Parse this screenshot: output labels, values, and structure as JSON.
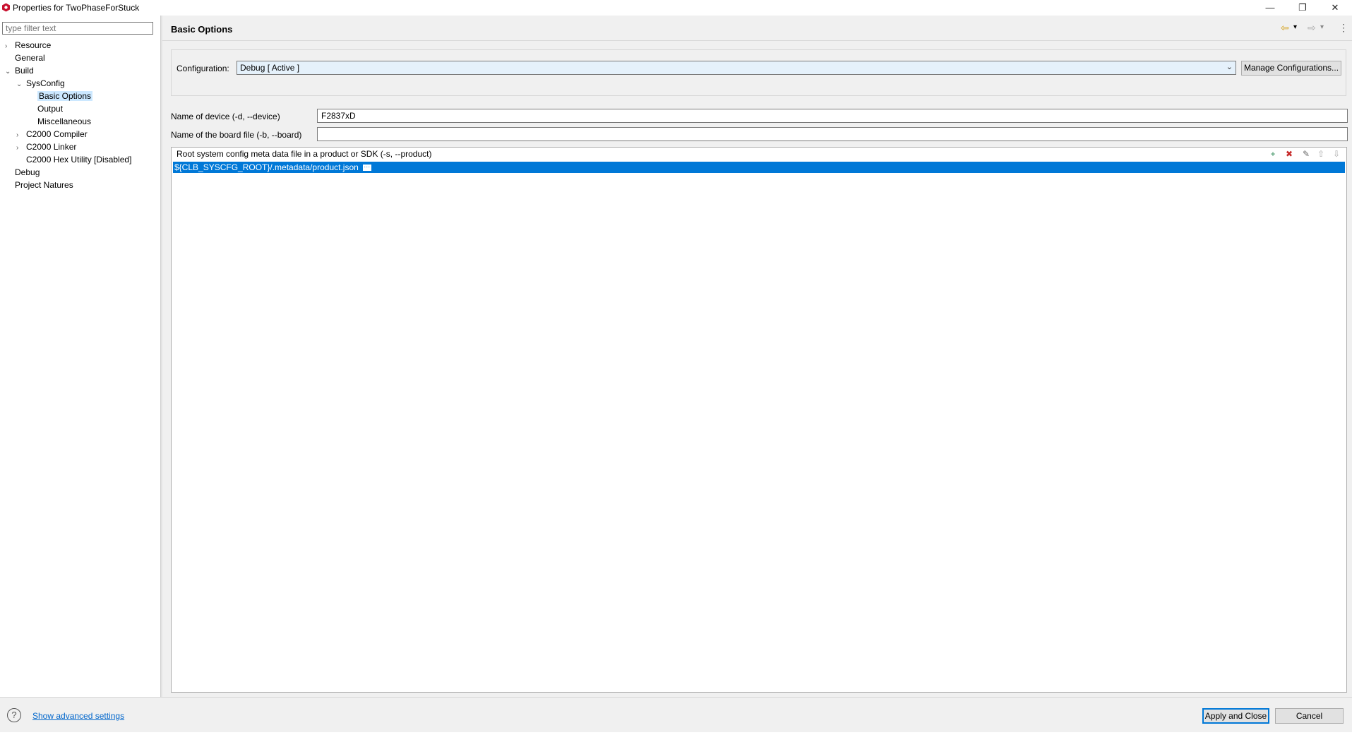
{
  "window": {
    "title": "Properties for TwoPhaseForStuck",
    "minimize": "—",
    "restore": "❐",
    "close": "✕"
  },
  "filter": {
    "placeholder": "type filter text"
  },
  "tree": [
    {
      "label": "Resource",
      "expander": "›"
    },
    {
      "label": "General",
      "expander": ""
    },
    {
      "label": "Build",
      "expander": "⌄"
    },
    {
      "label": "SysConfig",
      "expander": "⌄"
    },
    {
      "label": "Basic Options",
      "expander": "",
      "selected": true
    },
    {
      "label": "Output",
      "expander": ""
    },
    {
      "label": "Miscellaneous",
      "expander": ""
    },
    {
      "label": "C2000 Compiler",
      "expander": "›"
    },
    {
      "label": "C2000 Linker",
      "expander": "›"
    },
    {
      "label": "C2000 Hex Utility  [Disabled]",
      "expander": ""
    },
    {
      "label": "Debug",
      "expander": ""
    },
    {
      "label": "Project Natures",
      "expander": ""
    }
  ],
  "page_title": "Basic Options",
  "nav": {
    "back": "⇦",
    "forward": "⇨",
    "dropdown": "▾",
    "menu": "⋮"
  },
  "configuration": {
    "label": "Configuration:",
    "value": "Debug  [ Active ]",
    "chevron": "⌄",
    "manage_button": "Manage Configurations..."
  },
  "fields": {
    "device_label": "Name of device (-d, --device)",
    "device_value": "F2837xD",
    "board_label": "Name of the board file (-b, --board)",
    "board_value": ""
  },
  "product_list": {
    "header": "Root system config meta data file in a product or SDK (-s, --product)",
    "items": [
      "${CLB_SYSCFG_ROOT}/.metadata/product.json"
    ],
    "more": "···",
    "tools": {
      "add": "+",
      "delete": "✖",
      "edit": "✎",
      "up": "⇧",
      "down": "⇩"
    }
  },
  "footer": {
    "help": "?",
    "advanced_link": "Show advanced settings",
    "apply_button": "Apply and Close",
    "cancel_button": "Cancel"
  },
  "colors": {
    "selection": "#0078d7",
    "tree_selection": "#cce8ff",
    "link": "#0066cc",
    "app_icon": "#c8102e"
  }
}
